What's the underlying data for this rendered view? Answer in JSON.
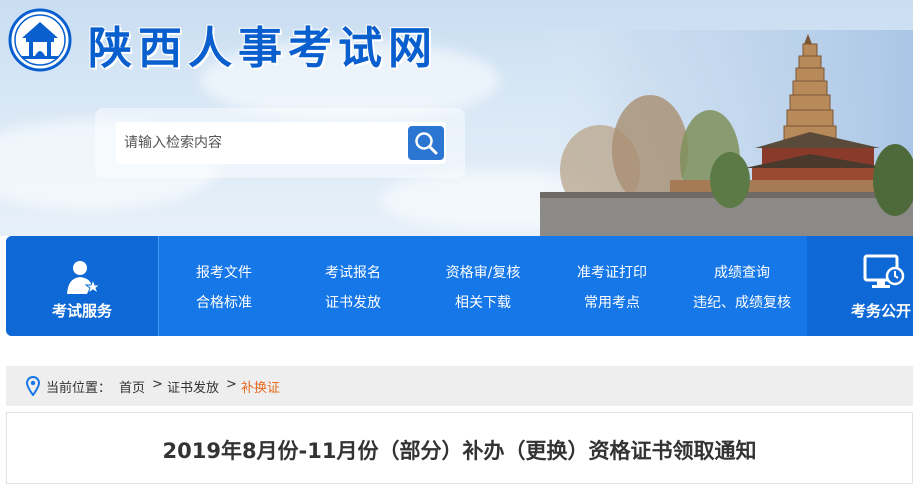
{
  "header": {
    "site_title": "陕西人事考试网",
    "logo_icon": "pagoda-gate-logo-icon",
    "search": {
      "placeholder": "请输入检索内容",
      "value": "",
      "button_icon": "search-icon"
    }
  },
  "nav": {
    "left": {
      "label": "考试服务",
      "icon": "person-star-icon"
    },
    "columns": [
      [
        "报考文件",
        "合格标准"
      ],
      [
        "考试报名",
        "证书发放"
      ],
      [
        "资格审/复核",
        "相关下载"
      ],
      [
        "准考证打印",
        "常用考点"
      ],
      [
        "成绩查询",
        "违纪、成绩复核"
      ]
    ],
    "right": {
      "label": "考务公开",
      "icon": "monitor-clock-icon"
    }
  },
  "breadcrumb": {
    "icon": "location-pin-icon",
    "label": "当前位置：",
    "items": [
      "首页",
      "证书发放",
      "补换证"
    ],
    "separator": ">"
  },
  "article": {
    "title": "2019年8月份-11月份（部分）补办（更换）资格证书领取通知"
  },
  "colors": {
    "primary_blue": "#1677e8",
    "dark_blue": "#0e69d6",
    "title_blue": "#0a5fcf",
    "breadcrumb_current": "#e56a1b"
  }
}
